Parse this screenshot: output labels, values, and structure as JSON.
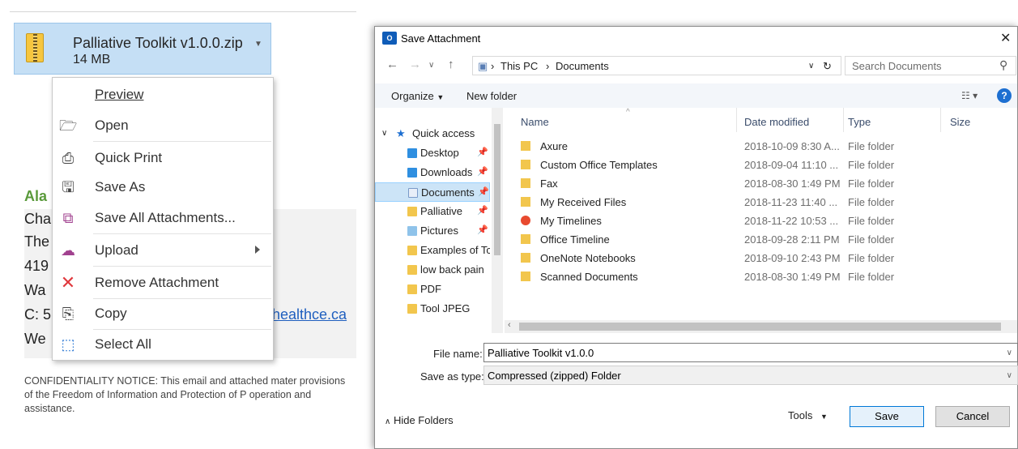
{
  "email": {
    "attachment": {
      "name": "Palliative Toolkit v1.0.0.zip",
      "size": "14 MB"
    },
    "signature": {
      "name": "Ala",
      "lines": [
        "Cha",
        "The",
        "419",
        "Wa",
        "C: 5",
        "We"
      ],
      "link_fragment": "healthce.ca"
    },
    "confidentiality": "CONFIDENTIALITY NOTICE: This email and attached mater provisions of the Freedom of Information and Protection of P operation and assistance."
  },
  "context_menu": {
    "items": [
      {
        "label": "Preview",
        "icon": "preview-icon"
      },
      {
        "label": "Open",
        "icon": "folder-open-icon"
      },
      {
        "label": "Quick Print",
        "icon": "printer-icon"
      },
      {
        "label": "Save As",
        "icon": "save-as-icon"
      },
      {
        "label": "Save All Attachments...",
        "icon": "save-all-icon"
      },
      {
        "label": "Upload",
        "icon": "upload-icon"
      },
      {
        "label": "Remove Attachment",
        "icon": "remove-x-icon"
      },
      {
        "label": "Copy",
        "icon": "copy-icon"
      },
      {
        "label": "Select All",
        "icon": "select-all-icon"
      }
    ]
  },
  "dialog": {
    "title": "Save Attachment",
    "breadcrumb": [
      "This PC",
      "Documents"
    ],
    "search_placeholder": "Search Documents",
    "toolbar": {
      "organize": "Organize",
      "new_folder": "New folder"
    },
    "nav": {
      "quick_access": "Quick access",
      "items": [
        "Desktop",
        "Downloads",
        "Documents",
        "Palliative",
        "Pictures",
        "Examples of Tc",
        "low back pain",
        "PDF",
        "Tool JPEG"
      ],
      "selected": "Documents"
    },
    "columns": {
      "name": "Name",
      "date": "Date modified",
      "type": "Type",
      "size": "Size"
    },
    "files": [
      {
        "name": "Axure",
        "date": "2018-10-09 8:30 A...",
        "type": "File folder"
      },
      {
        "name": "Custom Office Templates",
        "date": "2018-09-04 11:10 ...",
        "type": "File folder"
      },
      {
        "name": "Fax",
        "date": "2018-08-30 1:49 PM",
        "type": "File folder"
      },
      {
        "name": "My Received Files",
        "date": "2018-11-23 11:40 ...",
        "type": "File folder"
      },
      {
        "name": "My Timelines",
        "date": "2018-11-22 10:53 ...",
        "type": "File folder"
      },
      {
        "name": "Office Timeline",
        "date": "2018-09-28 2:11 PM",
        "type": "File folder"
      },
      {
        "name": "OneNote Notebooks",
        "date": "2018-09-10 2:43 PM",
        "type": "File folder"
      },
      {
        "name": "Scanned Documents",
        "date": "2018-08-30 1:49 PM",
        "type": "File folder"
      }
    ],
    "file_name_label": "File name:",
    "file_name": "Palliative Toolkit v1.0.0",
    "save_type_label": "Save as type:",
    "save_type": "Compressed (zipped) Folder",
    "hide_folders": "Hide Folders",
    "tools": "Tools",
    "save": "Save",
    "cancel": "Cancel"
  }
}
